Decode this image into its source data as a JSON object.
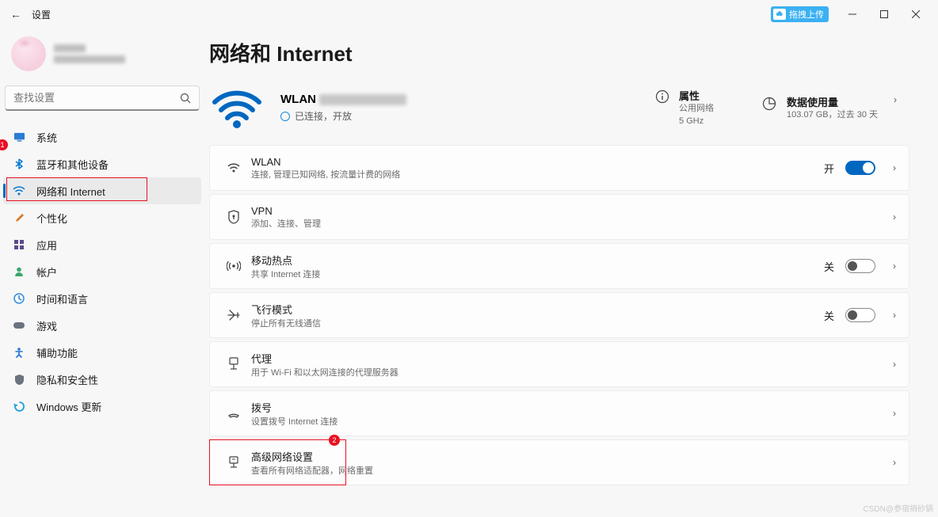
{
  "titlebar": {
    "back": "←",
    "title": "设置",
    "upload_label": "拖拽上传"
  },
  "profile": {
    "name_blur1_w": 40,
    "name_blur2_w": 90
  },
  "search": {
    "placeholder": "查找设置"
  },
  "sidebar": {
    "items": [
      {
        "label": "系统",
        "icon": "monitor-icon",
        "color": "#2b7cd3"
      },
      {
        "label": "蓝牙和其他设备",
        "icon": "bluetooth-icon",
        "color": "#0078d4",
        "annot": "1"
      },
      {
        "label": "网络和 Internet",
        "icon": "wifi-icon",
        "color": "#0078d4",
        "selected": true
      },
      {
        "label": "个性化",
        "icon": "brush-icon",
        "color": "#d97b2b"
      },
      {
        "label": "应用",
        "icon": "apps-icon",
        "color": "#5a4a8a"
      },
      {
        "label": "帐户",
        "icon": "person-icon",
        "color": "#3aa76d"
      },
      {
        "label": "时间和语言",
        "icon": "clock-lang-icon",
        "color": "#2e8bdb"
      },
      {
        "label": "游戏",
        "icon": "gamepad-icon",
        "color": "#6b7280"
      },
      {
        "label": "辅助功能",
        "icon": "accessibility-icon",
        "color": "#1e73d6"
      },
      {
        "label": "隐私和安全性",
        "icon": "shield-icon",
        "color": "#6b7280"
      },
      {
        "label": "Windows 更新",
        "icon": "update-icon",
        "color": "#1a9fe0"
      }
    ]
  },
  "page": {
    "title": "网络和 Internet",
    "hero": {
      "ssid_prefix": "WLAN",
      "status": "已连接，开放"
    },
    "properties": {
      "title": "属性",
      "line1": "公用网络",
      "line2": "5 GHz"
    },
    "data_usage": {
      "title": "数据使用量",
      "line1": "103.07 GB，过去 30 天"
    },
    "cards": [
      {
        "icon": "wifi-icon",
        "title": "WLAN",
        "sub": "连接, 管理已知网络, 按流量计费的网络",
        "toggle_state": "开",
        "toggle_on": true
      },
      {
        "icon": "vpn-shield-icon",
        "title": "VPN",
        "sub": "添加、连接、管理"
      },
      {
        "icon": "hotspot-icon",
        "title": "移动热点",
        "sub": "共享 Internet 连接",
        "toggle_state": "关",
        "toggle_on": false
      },
      {
        "icon": "airplane-icon",
        "title": "飞行模式",
        "sub": "停止所有无线通信",
        "toggle_state": "关",
        "toggle_on": false
      },
      {
        "icon": "proxy-icon",
        "title": "代理",
        "sub": "用于 Wi-Fi 和以太网连接的代理服务器"
      },
      {
        "icon": "dialup-icon",
        "title": "拨号",
        "sub": "设置拨号 Internet 连接"
      },
      {
        "icon": "adapter-icon",
        "title": "高级网络设置",
        "sub": "查看所有网络适配器，网络重置",
        "annot": "2"
      }
    ]
  },
  "watermark": "CSDN@参宿捎砂锅"
}
